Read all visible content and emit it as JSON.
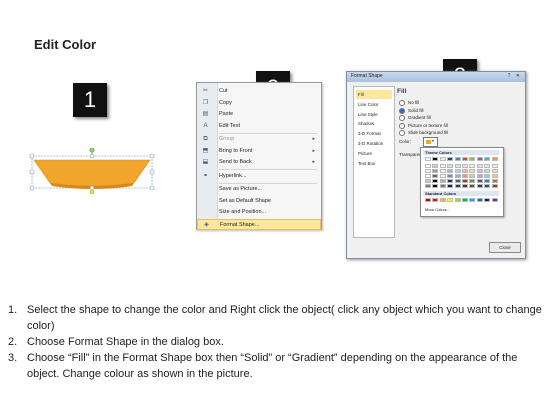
{
  "page": {
    "title": "Edit Color"
  },
  "steps": [
    "1",
    "2",
    "3"
  ],
  "context_menu": {
    "items": [
      {
        "label": "Cut",
        "icon": "scissors-icon",
        "glyph": "✂",
        "disabled": false,
        "submenu": false,
        "highlighted": false
      },
      {
        "label": "Copy",
        "icon": "copy-icon",
        "glyph": "❐",
        "disabled": false,
        "submenu": false,
        "highlighted": false
      },
      {
        "label": "Paste",
        "icon": "paste-icon",
        "glyph": "▤",
        "disabled": false,
        "submenu": false,
        "highlighted": false
      },
      {
        "label": "Edit Text",
        "icon": "edit-text-icon",
        "glyph": "A",
        "disabled": false,
        "submenu": false,
        "highlighted": false,
        "sep_after": true
      },
      {
        "label": "Group",
        "icon": "group-icon",
        "glyph": "⧉",
        "disabled": true,
        "submenu": true,
        "highlighted": false
      },
      {
        "label": "Bring to Front",
        "icon": "bring-front-icon",
        "glyph": "⬒",
        "disabled": false,
        "submenu": true,
        "highlighted": false
      },
      {
        "label": "Send to Back",
        "icon": "send-back-icon",
        "glyph": "⬓",
        "disabled": false,
        "submenu": true,
        "highlighted": false,
        "sep_after": true
      },
      {
        "label": "Hyperlink...",
        "icon": "hyperlink-icon",
        "glyph": "⚭",
        "disabled": false,
        "submenu": false,
        "highlighted": false,
        "sep_after": true
      },
      {
        "label": "Save as Picture...",
        "icon": "",
        "glyph": "",
        "disabled": false,
        "submenu": false,
        "highlighted": false
      },
      {
        "label": "Set as Default Shape",
        "icon": "",
        "glyph": "",
        "disabled": false,
        "submenu": false,
        "highlighted": false
      },
      {
        "label": "Size and Position...",
        "icon": "",
        "glyph": "",
        "disabled": false,
        "submenu": false,
        "highlighted": false
      },
      {
        "label": "Format Shape...",
        "icon": "format-shape-icon",
        "glyph": "◈",
        "disabled": false,
        "submenu": false,
        "highlighted": true
      }
    ]
  },
  "dialog": {
    "title": "Format Shape",
    "title_buttons": "? ✕",
    "categories": [
      "Fill",
      "Line Color",
      "Line Style",
      "Shadow",
      "3-D Format",
      "3-D Rotation",
      "Picture",
      "Text Box"
    ],
    "selected_category": "Fill",
    "fill_heading": "Fill",
    "fill_options": [
      {
        "label": "No fill",
        "selected": false
      },
      {
        "label": "Solid fill",
        "selected": true
      },
      {
        "label": "Gradient fill",
        "selected": false
      },
      {
        "label": "Picture or texture fill",
        "selected": false
      },
      {
        "label": "Slide background fill",
        "selected": false
      }
    ],
    "color_label": "Color:",
    "transparency_label": "Transparency:",
    "close_label": "Close"
  },
  "palette": {
    "theme_label": "Theme Colors",
    "standard_label": "Standard Colors",
    "more_label": "More Colors...",
    "theme_colors": [
      "#ffffff",
      "#000000",
      "#eeece1",
      "#1f497d",
      "#4f81bd",
      "#c0504d",
      "#9bbb59",
      "#8064a2",
      "#4bacc6",
      "#f79646"
    ],
    "standard_colors": [
      "#c00000",
      "#ff0000",
      "#ffc000",
      "#ffff00",
      "#92d050",
      "#00b050",
      "#00b0f0",
      "#0070c0",
      "#002060",
      "#7030a0"
    ]
  },
  "shape": {
    "fill_color": "#f2a52c",
    "selection_color": "#8ab2e2",
    "handle_color": "#6ab04c"
  },
  "instructions": [
    {
      "num": "1.",
      "text": "Select the shape to change the color and Right click the object( click any object which you want to change color)"
    },
    {
      "num": "2.",
      "text": "Choose Format Shape in the dialog box."
    },
    {
      "num": "3.",
      "text": "Choose “Fill” in the Format Shape box then “Solid” or “Gradient” depending on the appearance of the object. Change colour as shown in the picture."
    }
  ]
}
